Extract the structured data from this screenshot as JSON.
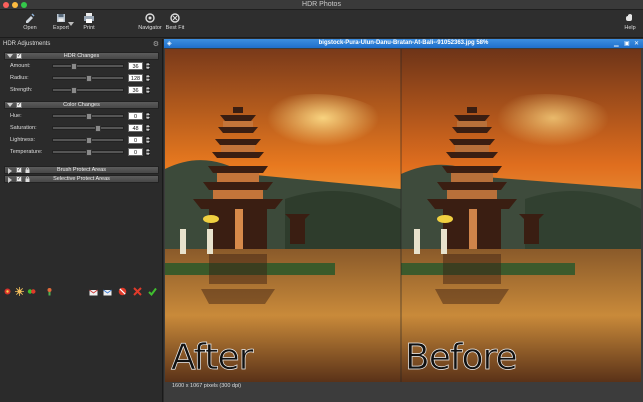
{
  "window": {
    "title": "HDR Photos"
  },
  "toolbar": {
    "open": "Open",
    "export": "Export",
    "print": "Print",
    "navigator": "Navigator",
    "best_fit": "Best Fit",
    "help": "Help"
  },
  "panel": {
    "title": "HDR Adjustments",
    "hdr_changes": {
      "label": "HDR Changes",
      "rows": [
        {
          "name": "Amount:",
          "value": "36",
          "level": 0.28
        },
        {
          "name": "Radius:",
          "value": "128",
          "level": 0.5
        },
        {
          "name": "Strength:",
          "value": "36",
          "level": 0.28
        }
      ]
    },
    "color_changes": {
      "label": "Color Changes",
      "rows": [
        {
          "name": "Hue:",
          "value": "0",
          "level": 0.5
        },
        {
          "name": "Saturation:",
          "value": "48",
          "level": 0.64
        },
        {
          "name": "Lightness:",
          "value": "0",
          "level": 0.5
        },
        {
          "name": "Temperature:",
          "value": "0",
          "level": 0.5
        }
      ]
    },
    "brush_protect": "Brush Protect Areas",
    "selective_protect": "Selective Protect Areas"
  },
  "image_window": {
    "title": "bigstock-Pura-Ulun-Danu-Bratan-At-Bali--91052363.jpg 58%",
    "after_label": "After",
    "before_label": "Before",
    "status": "1600 x 1067 pixels (300 dpi)"
  },
  "colors": {
    "titlebar_blue": "#2a7bd6",
    "sky_orange": "#e8791f",
    "apply_green": "#3fbf2f",
    "cancel_red": "#e03a2a"
  }
}
